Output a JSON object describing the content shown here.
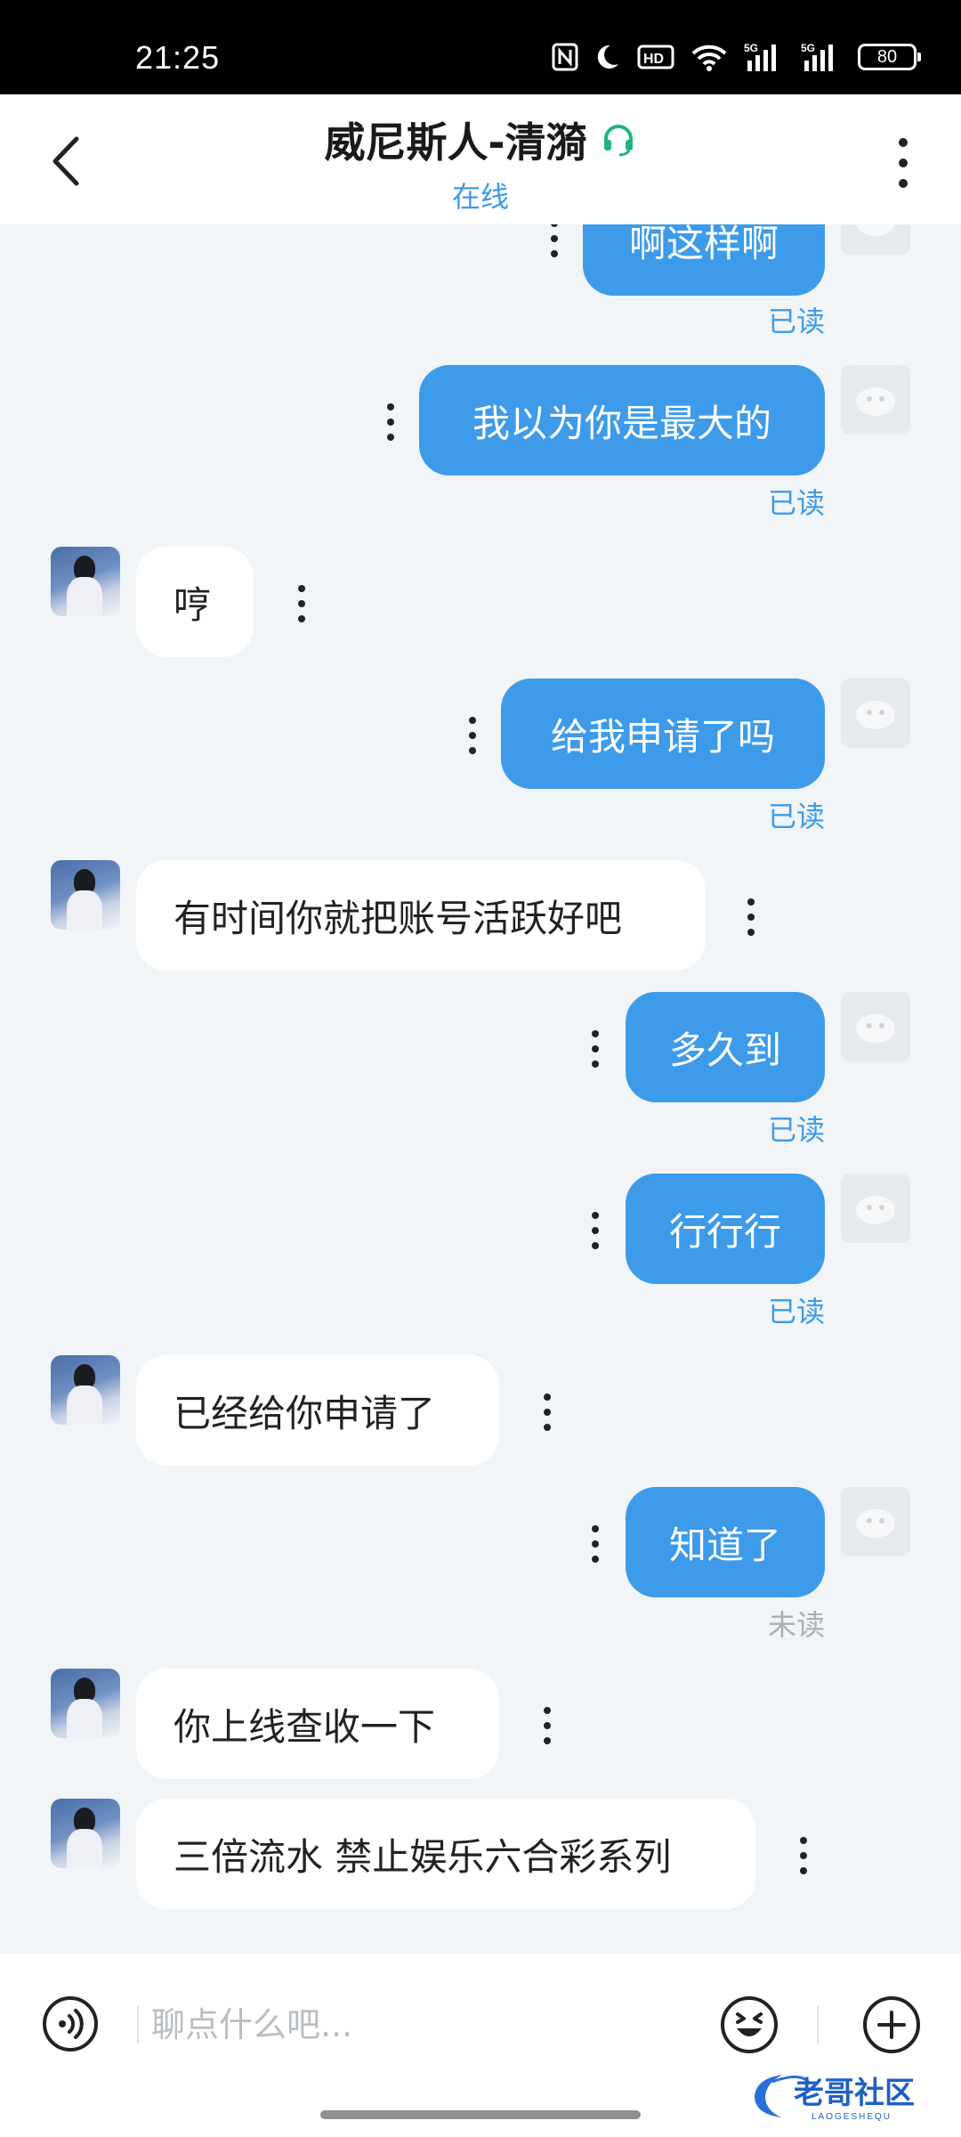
{
  "status_bar": {
    "time": "21:25",
    "battery": "80",
    "icons": [
      "nfc-icon",
      "moon-icon",
      "hd-icon",
      "wifi-icon",
      "signal-5g-icon",
      "signal-5g-icon",
      "battery-icon"
    ]
  },
  "header": {
    "title": "威尼斯人-清漪",
    "status": "在线",
    "title_badge_icon": "headset-icon"
  },
  "messages": [
    {
      "side": "out",
      "text": "啊这样啊",
      "receipt": "已读"
    },
    {
      "side": "out",
      "text": "我以为你是最大的",
      "receipt": "已读"
    },
    {
      "side": "in",
      "text": "哼"
    },
    {
      "side": "out",
      "text": "给我申请了吗",
      "receipt": "已读"
    },
    {
      "side": "in",
      "text": "有时间你就把账号活跃好吧"
    },
    {
      "side": "out",
      "text": "多久到",
      "receipt": "已读"
    },
    {
      "side": "out",
      "text": "行行行",
      "receipt": "已读"
    },
    {
      "side": "in",
      "text": "已经给你申请了"
    },
    {
      "side": "out",
      "text": "知道了",
      "receipt": "未读"
    },
    {
      "side": "in",
      "text": "你上线查收一下"
    },
    {
      "side": "in",
      "text": "三倍流水 禁止娱乐六合彩系列"
    }
  ],
  "input": {
    "placeholder": "聊点什么吧..."
  },
  "watermark": {
    "text": "老哥社区",
    "subtext": "LAOGESHEQU"
  },
  "colors": {
    "accent": "#3d9be9",
    "unread": "#a9afb5",
    "headset": "#1fb57a",
    "background": "#f1f5f7"
  }
}
